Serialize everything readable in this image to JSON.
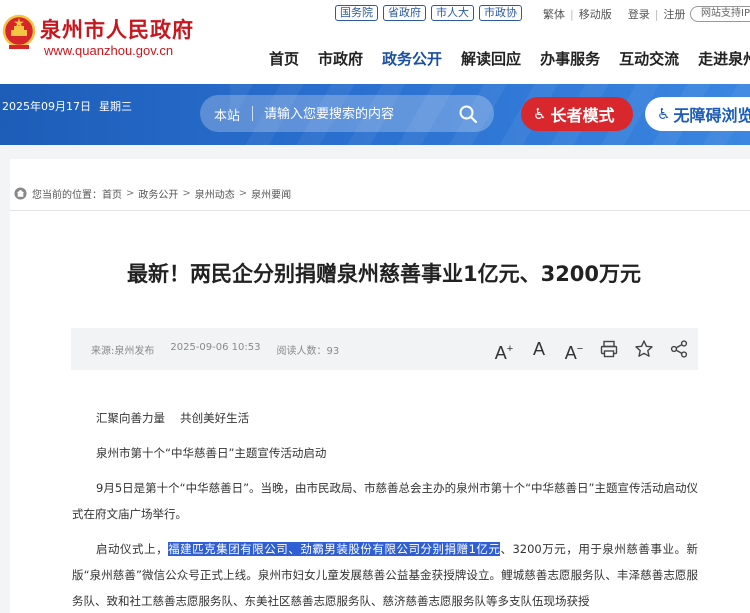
{
  "site": {
    "title": "泉州市人民政府",
    "url": "www.quanzhou.gov.cn",
    "top_links": [
      "国务院",
      "省政府",
      "市人大",
      "市政协"
    ],
    "util_links": [
      "繁体",
      "移动版",
      "登录",
      "注册"
    ],
    "accessible_label": "网站支持IPv"
  },
  "nav": [
    "首页",
    "市政府",
    "政务公开",
    "解读回应",
    "办事服务",
    "互动交流",
    "走进泉州"
  ],
  "banner": {
    "date": "2025年09月17日",
    "weekday": "星期三",
    "search_scope": "本站",
    "search_placeholder": "请输入您要搜索的内容",
    "elder_mode": "长者模式",
    "accessibility": "无障碍浏览"
  },
  "breadcrumb": {
    "prefix": "您当前的位置：",
    "items": [
      "首页",
      "政务公开",
      "泉州动态",
      "泉州要闻"
    ]
  },
  "article": {
    "title": "最新！两民企分别捐赠泉州慈善事业1亿元、3200万元",
    "source": "来源:泉州发布",
    "date": "2025-09-06 10:53",
    "reads": "阅读人数：93",
    "p1": "汇聚向善力量　 共创美好生活",
    "p2": "泉州市第十个“中华慈善日”主题宣传活动启动",
    "p3": "9月5日是第十个“中华慈善日”。当晚，由市民政局、市慈善总会主办的泉州市第十个“中华慈善日”主题宣传活动启动仪式在府文庙广场举行。",
    "p4_pre": "启动仪式上，",
    "p4_hl": "福建匹克集团有限公司、劲霸男装股份有限公司分别捐赠1亿元",
    "p4_post": "、3200万元，用于泉州慈善事业。新版“泉州慈善”微信公众号正式上线。泉州市妇女儿童发展慈善公益基金获授牌设立。鲤城慈善志愿服务队、丰泽慈善志愿服务队、致和社工慈善志愿服务队、东美社区慈善志愿服务队、慈济慈善志愿服务队等多支队伍现场获授"
  },
  "colors": {
    "brand_red": "#c8161d",
    "nav_active": "#1a4fa0",
    "banner_blue": "#2a6fcf",
    "elder_red": "#d8272d",
    "highlight": "#2f5fd3"
  },
  "icons": {
    "emblem": "national-emblem-icon",
    "search": "search-icon",
    "elder": "elder-icon",
    "wheelchair": "wheelchair-icon",
    "home": "home-icon",
    "font_increase": "font-increase-icon",
    "font_reset": "font-reset-icon",
    "font_decrease": "font-decrease-icon",
    "print": "print-icon",
    "favorite": "star-icon",
    "share": "share-icon"
  }
}
